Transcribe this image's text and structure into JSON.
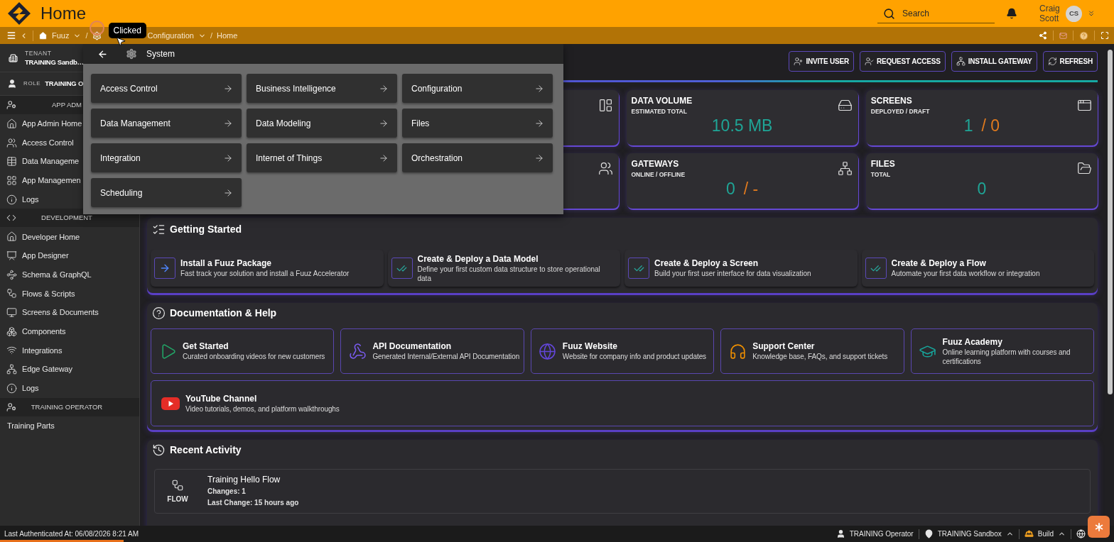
{
  "header": {
    "title": "Home",
    "search": {
      "placeholder": "Search"
    },
    "user": {
      "name": "Craig Scott",
      "initials": "CS"
    }
  },
  "breadcrumb": {
    "items": [
      {
        "kind": "home",
        "label": "Fuuz",
        "dropdown": true
      },
      {
        "kind": "separator",
        "label": "/"
      },
      {
        "kind": "covered"
      },
      {
        "kind": "text",
        "label": "Configuration",
        "dropdown": true
      },
      {
        "kind": "separator",
        "label": "/"
      },
      {
        "kind": "text",
        "label": "Home",
        "dropdown": false
      }
    ],
    "tooltip": "Clicked"
  },
  "sidebar": {
    "tenant": {
      "label": "TENANT",
      "value": "TRAINING Sandb…"
    },
    "role": {
      "label": "ROLE",
      "value": "TRAINING O"
    },
    "sections": [
      {
        "title": "APP ADM",
        "items": [
          "App Admin Home",
          "Access Control",
          "Data Manageme",
          "App Managemen",
          "Logs"
        ]
      },
      {
        "title": "DEVELOPMENT",
        "items": [
          "Developer Home",
          "App Designer",
          "Schema & GraphQL",
          "Flows & Scripts",
          "Screens & Documents",
          "Components",
          "Integrations",
          "Edge Gateway",
          "Logs"
        ]
      },
      {
        "title": "TRAINING OPERATOR",
        "items": [
          "Training Parts"
        ]
      }
    ]
  },
  "system_menu": {
    "title": "System",
    "items": [
      "Access Control",
      "Business Intelligence",
      "Configuration",
      "Data Management",
      "Data Modeling",
      "Files",
      "Integration",
      "Internet of Things",
      "Orchestration",
      "Scheduling"
    ]
  },
  "toolbar": {
    "buttons": [
      "INVITE USER",
      "REQUEST ACCESS",
      "INSTALL GATEWAY",
      "REFRESH"
    ]
  },
  "stat_rows": [
    [
      {
        "kind": "covered"
      },
      {
        "kind": "metric",
        "title": "DATA VOLUME",
        "subtitle": "ESTIMATED TOTAL",
        "value": "10.5 MB"
      },
      {
        "kind": "metric",
        "title": "SCREENS",
        "subtitle": "DEPLOYED / DRAFT",
        "value": "1",
        "secondary": "/ 0"
      }
    ],
    [
      {
        "kind": "covered"
      },
      {
        "kind": "metric",
        "title": "GATEWAYS",
        "subtitle": "ONLINE / OFFLINE",
        "value": "0",
        "secondary": "/ -"
      },
      {
        "kind": "metric",
        "title": "FILES",
        "subtitle": "TOTAL",
        "value": "0"
      }
    ]
  ],
  "getting_started": {
    "title": "Getting Started",
    "steps": [
      {
        "title": "Install a Fuuz Package",
        "description": "Fast track your solution and install a Fuuz Accelerator",
        "done": false
      },
      {
        "title": "Create & Deploy a Data Model",
        "description": "Define your first custom data structure to store operational data",
        "done": true
      },
      {
        "title": "Create & Deploy a Screen",
        "description": "Build your first user interface for data visualization",
        "done": true
      },
      {
        "title": "Create & Deploy a Flow",
        "description": "Automate your first data workflow or integration",
        "done": true
      }
    ]
  },
  "documentation": {
    "title": "Documentation & Help",
    "links": [
      {
        "title": "Get Started",
        "description": "Curated onboarding videos for new customers"
      },
      {
        "title": "API Documentation",
        "description": "Generated Internal/External API Documentation"
      },
      {
        "title": "Fuuz Website",
        "description": "Website for company info and product updates"
      },
      {
        "title": "Support Center",
        "description": "Knowledge base, FAQs, and support tickets"
      },
      {
        "title": "Fuuz Academy",
        "description": "Online learning platform with courses and certifications"
      },
      {
        "title": "YouTube Channel",
        "description": "Video tutorials, demos, and platform walkthroughs"
      }
    ]
  },
  "recent_activity": {
    "title": "Recent Activity",
    "items": [
      {
        "type": "FLOW",
        "title": "Training Hello Flow",
        "changes": "Changes: 1",
        "last_change": "Last Change: 15 hours ago"
      }
    ]
  },
  "status_bar": {
    "last_authenticated": "Last Authenticated At: 06/08/2026 8:21 AM",
    "loading_bar": {
      "level": 0.111
    },
    "items": [
      {
        "label": "TRAINING Operator",
        "expandable": false
      },
      {
        "label": "TRAINING Sandbox",
        "expandable": true
      },
      {
        "label": "Build",
        "expandable": true
      }
    ]
  }
}
